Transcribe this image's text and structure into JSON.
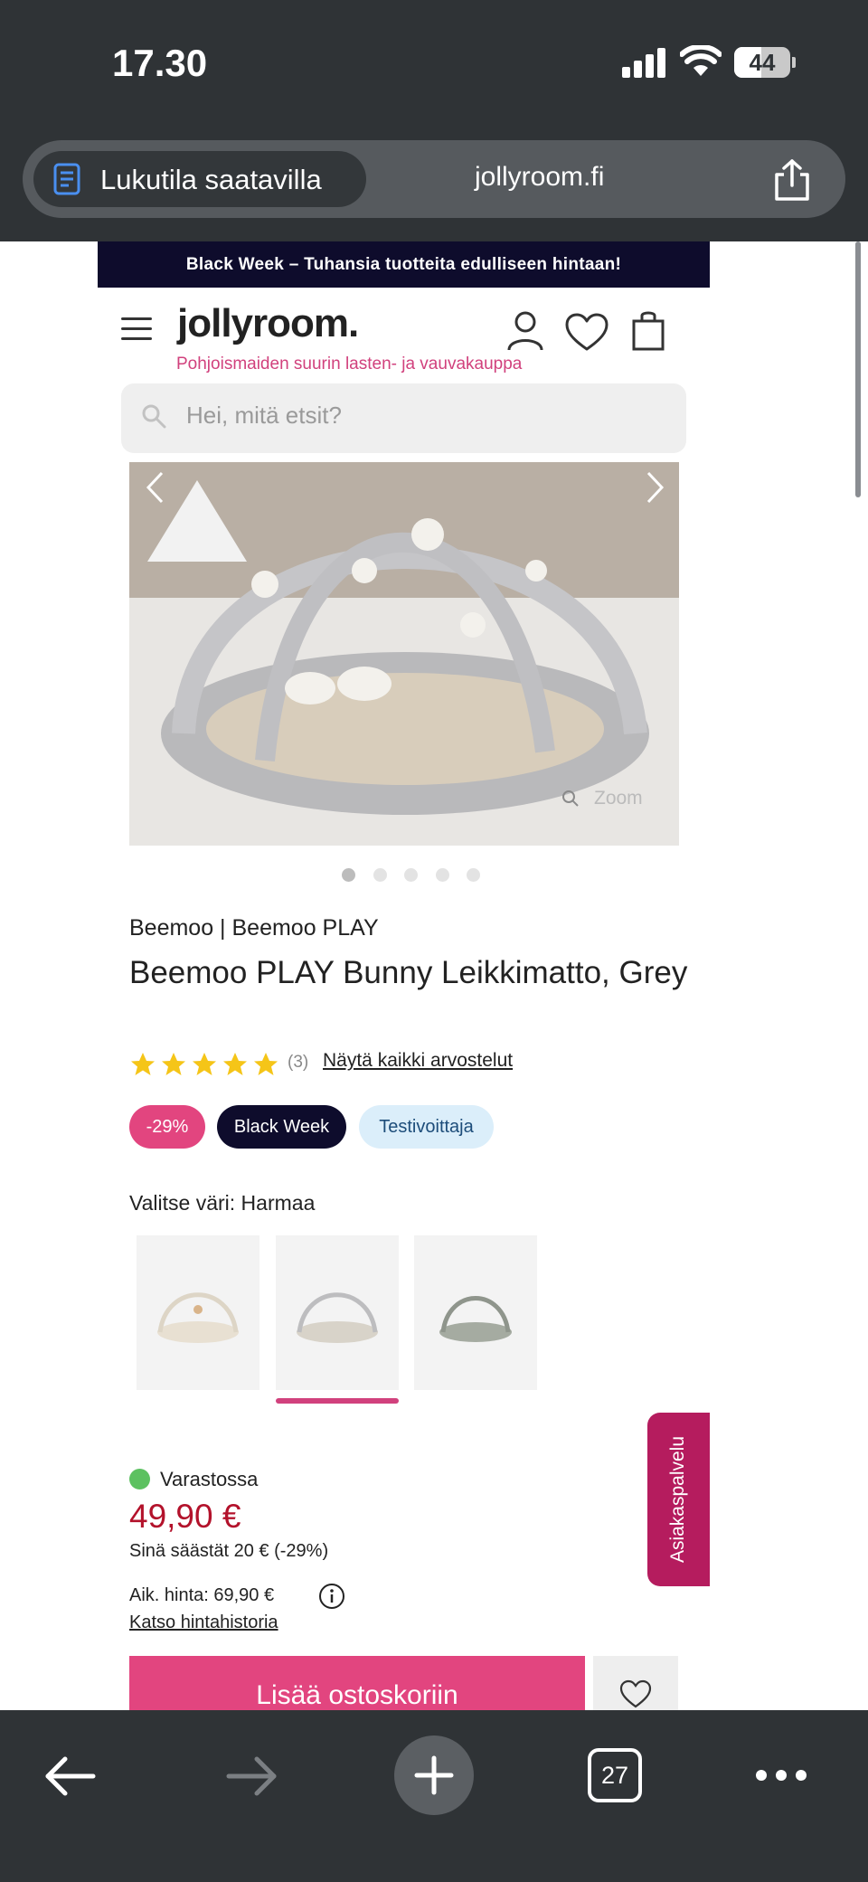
{
  "status": {
    "time": "17.30",
    "battery": "44"
  },
  "browser": {
    "reader_label": "Lukutila saatavilla",
    "url": "jollyroom.fi",
    "tab_count": "27"
  },
  "site": {
    "promo": "Black Week – Tuhansia tuotteita edulliseen hintaan!",
    "logo": "jollyroom.",
    "tagline": "Pohjoismaiden suurin lasten- ja vauvakauppa",
    "search_placeholder": "Hei, mitä etsit?"
  },
  "product": {
    "zoom_label": "Zoom",
    "brand": "Beemoo | Beemoo PLAY",
    "title": "Beemoo PLAY Bunny Leikkimatto, Grey",
    "rating": 5,
    "review_count": "(3)",
    "reviews_link": "Näytä kaikki arvostelut",
    "badges": [
      "-29%",
      "Black Week",
      "Testivoittaja"
    ],
    "color_label": "Valitse väri: Harmaa",
    "stock": "Varastossa",
    "price": "49,90 €",
    "savings": "Sinä säästät 20 € (-29%)",
    "previous_price": "Aik. hinta: 69,90 €",
    "history_link": "Katso hintahistoria",
    "add_to_cart": "Lisää ostoskoriin",
    "customer_service": "Asiakaspalvelu"
  },
  "colors": {
    "accent": "#e2457f",
    "brand_navy": "#0e0c2c",
    "price": "#b3122b",
    "stock": "#5cc160"
  }
}
